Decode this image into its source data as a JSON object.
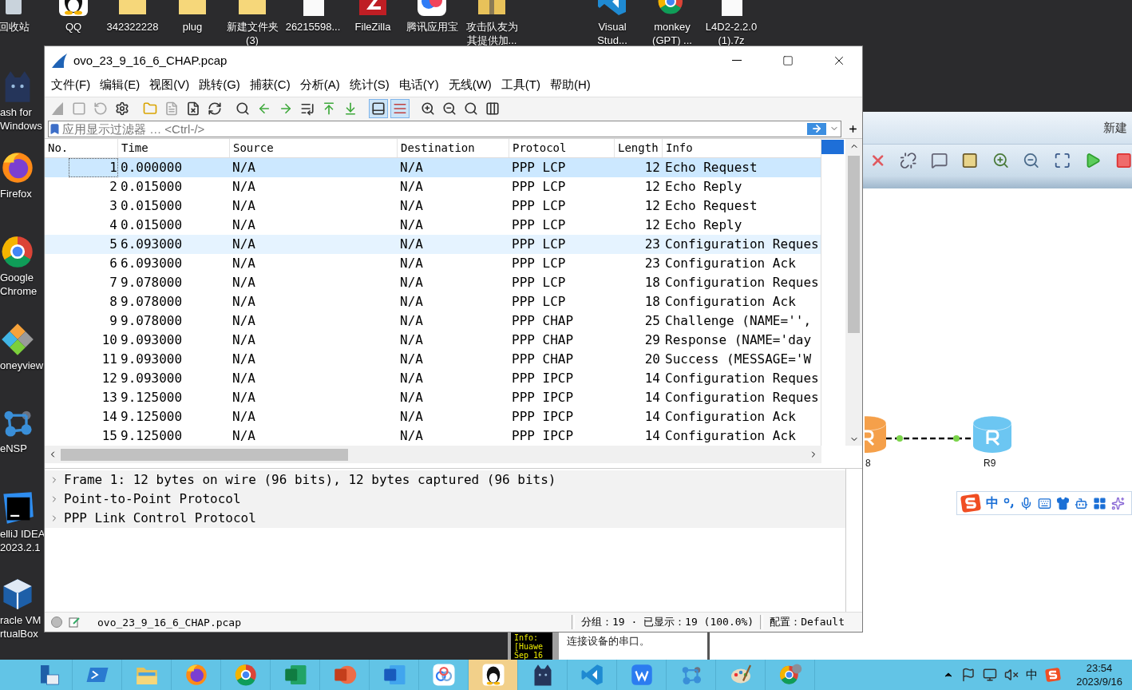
{
  "desktop_icons_top": [
    {
      "kind": "recycle-bin",
      "lines": [
        "回收站"
      ]
    },
    {
      "kind": "penguin",
      "lines": [
        "QQ"
      ]
    },
    {
      "kind": "folder",
      "lines": [
        "342322228"
      ]
    },
    {
      "kind": "folder",
      "lines": [
        "plug"
      ]
    },
    {
      "kind": "folder",
      "lines": [
        "新建文件夹",
        "(3)"
      ]
    },
    {
      "kind": "file",
      "lines": [
        "26215598..."
      ]
    },
    {
      "kind": "ftp",
      "lines": [
        "FileZilla"
      ]
    },
    {
      "kind": "swirl",
      "lines": [
        "腾讯应用宝"
      ]
    },
    {
      "kind": "zip",
      "lines": [
        "攻击队友为",
        "其提供加..."
      ]
    },
    {
      "kind": "code",
      "lines": [
        "Visual",
        "Stud..."
      ]
    },
    {
      "kind": "monkey",
      "lines": [
        "monkey",
        "(GPT) ..."
      ]
    },
    {
      "kind": "file",
      "lines": [
        "L4D2-2.2.0",
        "(1).7z"
      ]
    }
  ],
  "desktop_icons_left": [
    {
      "kind": "cat",
      "lines": [
        "ash for",
        "Windows"
      ]
    },
    {
      "kind": "firefox",
      "lines": [
        "Firefox"
      ]
    },
    {
      "kind": "chrome",
      "lines": [
        "Google",
        "Chrome"
      ]
    },
    {
      "kind": "diamonds",
      "lines": [
        "oneyview"
      ]
    },
    {
      "kind": "network",
      "lines": [
        "eNSP"
      ]
    },
    {
      "kind": "ide",
      "lines": [
        "elliJ IDEA",
        "2023.2.1"
      ]
    },
    {
      "kind": "cube",
      "lines": [
        "racle VM",
        "rtualBox"
      ]
    }
  ],
  "console_window": {
    "log_lines": [
      "Info:",
      "[Huawe",
      "Sep 16"
    ],
    "message": "连接设备的串口。"
  },
  "ensp_window": {
    "title": "新建",
    "nodes": [
      {
        "label": "8",
        "color": "#f5a04a"
      },
      {
        "label": "R9",
        "color": "#6cc6f2"
      }
    ],
    "ime_bar": {
      "mode": "中"
    }
  },
  "wireshark": {
    "title": "ovo_23_9_16_6_CHAP.pcap",
    "menu": [
      "文件(F)",
      "编辑(E)",
      "视图(V)",
      "跳转(G)",
      "捕获(C)",
      "分析(A)",
      "统计(S)",
      "电话(Y)",
      "无线(W)",
      "工具(T)",
      "帮助(H)"
    ],
    "toolbar": [
      {
        "kind": "start",
        "disabled": true,
        "pressed": false
      },
      {
        "kind": "stop",
        "disabled": true,
        "pressed": false
      },
      {
        "kind": "restart",
        "disabled": true,
        "pressed": false
      },
      {
        "kind": "options",
        "disabled": false,
        "pressed": false
      },
      {
        "kind": "open",
        "disabled": false,
        "pressed": false
      },
      {
        "kind": "save",
        "disabled": true,
        "pressed": false
      },
      {
        "kind": "close",
        "disabled": false,
        "pressed": false
      },
      {
        "kind": "reload",
        "disabled": false,
        "pressed": false
      },
      {
        "kind": "find",
        "disabled": false,
        "pressed": false
      },
      {
        "kind": "back",
        "disabled": false,
        "pressed": false
      },
      {
        "kind": "forward",
        "disabled": false,
        "pressed": false
      },
      {
        "kind": "goto",
        "disabled": false,
        "pressed": false
      },
      {
        "kind": "first",
        "disabled": false,
        "pressed": false
      },
      {
        "kind": "last",
        "disabled": false,
        "pressed": false
      },
      {
        "kind": "autoscroll",
        "disabled": false,
        "pressed": true
      },
      {
        "kind": "colorize",
        "disabled": false,
        "pressed": true
      },
      {
        "kind": "zoom-in",
        "disabled": false,
        "pressed": false
      },
      {
        "kind": "zoom-out",
        "disabled": false,
        "pressed": false
      },
      {
        "kind": "zoom-reset",
        "disabled": false,
        "pressed": false
      },
      {
        "kind": "resize",
        "disabled": false,
        "pressed": false
      }
    ],
    "filter": {
      "placeholder": "应用显示过滤器 … <Ctrl-/>"
    },
    "columns": [
      "No.",
      "Time",
      "Source",
      "Destination",
      "Protocol",
      "Length",
      "Info"
    ],
    "rows": [
      {
        "no": "1",
        "time": "0.000000",
        "source": "N/A",
        "destination": "N/A",
        "protocol": "PPP LCP",
        "length": "12",
        "info": "Echo Request",
        "selected": true,
        "hovered": false
      },
      {
        "no": "2",
        "time": "0.015000",
        "source": "N/A",
        "destination": "N/A",
        "protocol": "PPP LCP",
        "length": "12",
        "info": "Echo Reply",
        "selected": false,
        "hovered": false
      },
      {
        "no": "3",
        "time": "0.015000",
        "source": "N/A",
        "destination": "N/A",
        "protocol": "PPP LCP",
        "length": "12",
        "info": "Echo Request",
        "selected": false,
        "hovered": false
      },
      {
        "no": "4",
        "time": "0.015000",
        "source": "N/A",
        "destination": "N/A",
        "protocol": "PPP LCP",
        "length": "12",
        "info": "Echo Reply",
        "selected": false,
        "hovered": false
      },
      {
        "no": "5",
        "time": "6.093000",
        "source": "N/A",
        "destination": "N/A",
        "protocol": "PPP LCP",
        "length": "23",
        "info": "Configuration Reques",
        "selected": false,
        "hovered": true
      },
      {
        "no": "6",
        "time": "6.093000",
        "source": "N/A",
        "destination": "N/A",
        "protocol": "PPP LCP",
        "length": "23",
        "info": "Configuration Ack",
        "selected": false,
        "hovered": false
      },
      {
        "no": "7",
        "time": "9.078000",
        "source": "N/A",
        "destination": "N/A",
        "protocol": "PPP LCP",
        "length": "18",
        "info": "Configuration Reques",
        "selected": false,
        "hovered": false
      },
      {
        "no": "8",
        "time": "9.078000",
        "source": "N/A",
        "destination": "N/A",
        "protocol": "PPP LCP",
        "length": "18",
        "info": "Configuration Ack",
        "selected": false,
        "hovered": false
      },
      {
        "no": "9",
        "time": "9.078000",
        "source": "N/A",
        "destination": "N/A",
        "protocol": "PPP CHAP",
        "length": "25",
        "info": "Challenge (NAME='',",
        "selected": false,
        "hovered": false
      },
      {
        "no": "10",
        "time": "9.093000",
        "source": "N/A",
        "destination": "N/A",
        "protocol": "PPP CHAP",
        "length": "29",
        "info": "Response (NAME='day",
        "selected": false,
        "hovered": false
      },
      {
        "no": "11",
        "time": "9.093000",
        "source": "N/A",
        "destination": "N/A",
        "protocol": "PPP CHAP",
        "length": "20",
        "info": "Success (MESSAGE='W",
        "selected": false,
        "hovered": false
      },
      {
        "no": "12",
        "time": "9.093000",
        "source": "N/A",
        "destination": "N/A",
        "protocol": "PPP IPCP",
        "length": "14",
        "info": "Configuration Reques",
        "selected": false,
        "hovered": false
      },
      {
        "no": "13",
        "time": "9.125000",
        "source": "N/A",
        "destination": "N/A",
        "protocol": "PPP IPCP",
        "length": "14",
        "info": "Configuration Reques",
        "selected": false,
        "hovered": false
      },
      {
        "no": "14",
        "time": "9.125000",
        "source": "N/A",
        "destination": "N/A",
        "protocol": "PPP IPCP",
        "length": "14",
        "info": "Configuration Ack",
        "selected": false,
        "hovered": false
      },
      {
        "no": "15",
        "time": "9.125000",
        "source": "N/A",
        "destination": "N/A",
        "protocol": "PPP IPCP",
        "length": "14",
        "info": "Configuration Ack",
        "selected": false,
        "hovered": false
      }
    ],
    "details": [
      {
        "text": "Frame 1: 12 bytes on wire (96 bits), 12 bytes captured (96 bits)",
        "expanded": false
      },
      {
        "text": "Point-to-Point Protocol",
        "expanded": false
      },
      {
        "text": "PPP Link Control Protocol",
        "expanded": false
      }
    ],
    "status_bar": {
      "file": "ovo_23_9_16_6_CHAP.pcap",
      "packets": "分组：19 · 已显示：19 (100.0%)",
      "profile": "配置：Default"
    }
  },
  "taskbar": {
    "items": [
      {
        "kind": "server",
        "active": false
      },
      {
        "kind": "terminal",
        "active": false
      },
      {
        "kind": "explorer",
        "active": false
      },
      {
        "kind": "firefox",
        "active": false
      },
      {
        "kind": "chrome",
        "active": false
      },
      {
        "kind": "sheet",
        "active": false
      },
      {
        "kind": "slides",
        "active": false
      },
      {
        "kind": "doc",
        "active": false
      },
      {
        "kind": "cloud",
        "active": false
      },
      {
        "kind": "penguin",
        "active": true
      },
      {
        "kind": "cat",
        "active": false
      },
      {
        "kind": "code",
        "active": false
      },
      {
        "kind": "wps",
        "active": false
      },
      {
        "kind": "network",
        "active": false
      },
      {
        "kind": "palette",
        "active": false
      },
      {
        "kind": "monkey",
        "active": false
      }
    ],
    "tray": {
      "ime": "中"
    },
    "clock": {
      "time": "23:54",
      "date": "2023/9/16"
    }
  }
}
